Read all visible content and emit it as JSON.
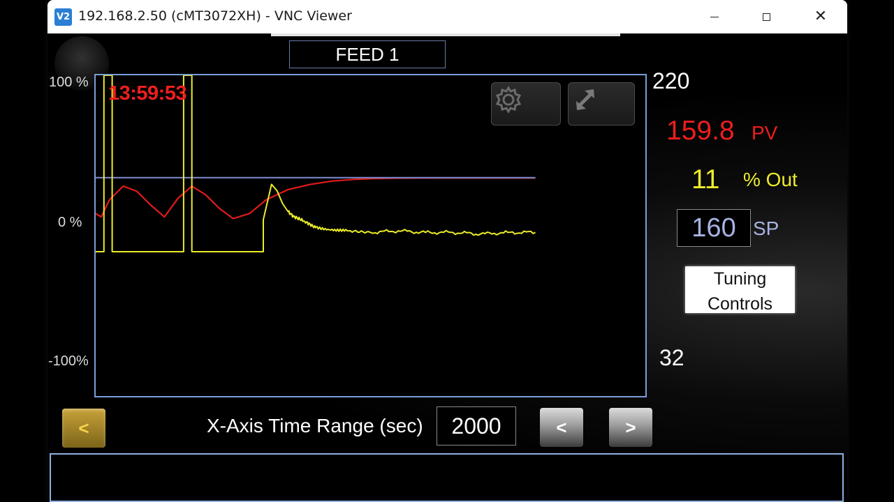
{
  "window": {
    "title": "192.168.2.50 (cMT3072XH) - VNC Viewer",
    "app_icon_text": "V2",
    "minimize_icon": "minimize-icon",
    "maximize_icon": "maximize-icon",
    "close_icon": "close-icon",
    "close_glyph": "✕"
  },
  "hmi": {
    "feed_title": "FEED 1",
    "timestamp": "13:59:53",
    "axis_left": {
      "top": "100 %",
      "mid": "0 %",
      "bottom": "-100%"
    },
    "axis_right": {
      "top": "220",
      "bottom": "32"
    },
    "pv": {
      "value": "159.8",
      "label": "PV"
    },
    "output": {
      "value": "11",
      "label": "% Out"
    },
    "sp": {
      "value": "160",
      "label": "SP"
    },
    "tuning_button": {
      "line1": "Tuning",
      "line2": "Controls"
    },
    "x_axis_range": {
      "label": "X-Axis Time Range (sec)",
      "value": "2000"
    },
    "back_button": "<",
    "prev_button": "<",
    "next_button": ">"
  },
  "colors": {
    "pv_trace": "#e11b1b",
    "output_trace": "#ecec2a",
    "setpoint_trace": "#7a86c8",
    "plot_border": "#7c9ed8"
  },
  "chart_data": {
    "type": "line",
    "title": "",
    "right_axis_range": [
      32,
      220
    ],
    "left_axis_range": [
      -100,
      100
    ],
    "left_axis_ticks": [
      "100 %",
      "0 %",
      "-100%"
    ],
    "right_axis_ticks": [
      "220",
      "32"
    ],
    "x_range_sec": 2000,
    "series": [
      {
        "name": "PV",
        "axis": "right",
        "color": "#e11b1b",
        "x": [
          0,
          20,
          50,
          100,
          150,
          200,
          250,
          300,
          350,
          400,
          450,
          500,
          560,
          620,
          700,
          780,
          860,
          940,
          1020,
          1100,
          1200,
          1300,
          1400,
          1500,
          1600
        ],
        "values": [
          139,
          137,
          147,
          155,
          152,
          144,
          137,
          148,
          155,
          150,
          142,
          136,
          139,
          147,
          153,
          156,
          158,
          159,
          159.5,
          159.7,
          159.8,
          159.8,
          159.8,
          159.8,
          159.8
        ]
      },
      {
        "name": "SP",
        "axis": "right",
        "color": "#7a86c8",
        "x": [
          0,
          1600
        ],
        "values": [
          160,
          160
        ]
      },
      {
        "name": "% Out",
        "axis": "left",
        "color": "#ecec2a",
        "x": [
          0,
          30,
          30,
          60,
          60,
          320,
          320,
          350,
          350,
          610,
          610,
          640,
          660,
          680,
          700,
          720,
          760,
          800,
          860,
          920,
          1000,
          1100,
          1200,
          1300,
          1400,
          1500,
          1600
        ],
        "values": [
          -10,
          -10,
          100,
          100,
          -10,
          -10,
          100,
          100,
          -10,
          -10,
          10,
          32,
          28,
          20,
          15,
          12,
          9,
          5,
          4,
          3,
          2,
          3,
          2,
          2,
          1,
          2,
          2
        ]
      }
    ]
  }
}
